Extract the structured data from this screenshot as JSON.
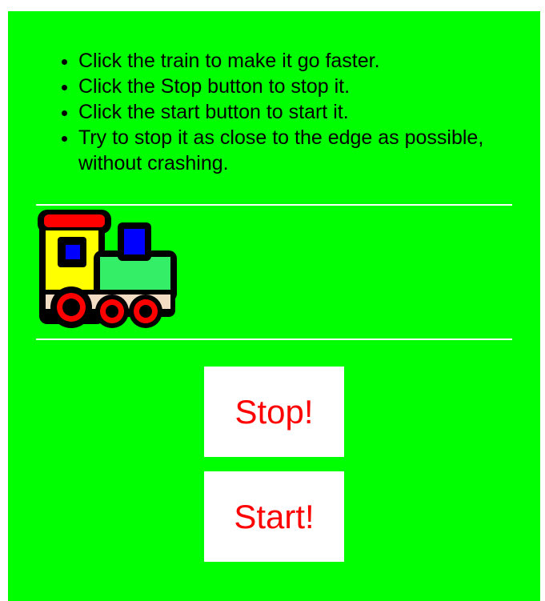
{
  "instructions": [
    "Click the train to make it go faster.",
    "Click the Stop button to stop it.",
    "Click the start button to start it.",
    "Try to stop it as close to the edge as possible, without crashing."
  ],
  "buttons": {
    "stop_label": "Stop!",
    "start_label": "Start!"
  },
  "colors": {
    "background": "#00ff00",
    "button_text": "#ff0000",
    "button_bg": "#ffffff",
    "track_lines": "#ffffff"
  },
  "icons": {
    "train": "toy-train-icon"
  }
}
